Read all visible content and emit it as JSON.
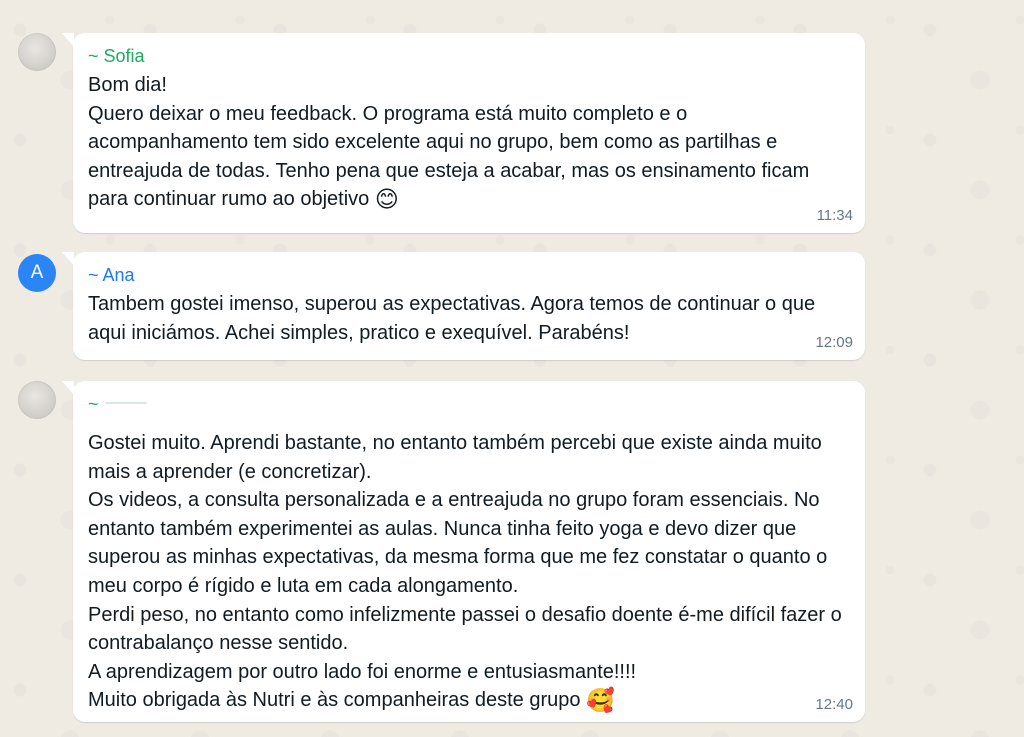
{
  "colors": {
    "background": "#efeae2",
    "bubble": "#ffffff",
    "sofia_name": "#1daa61",
    "ana_name": "#1c7ce8",
    "third_name": "#1daa61",
    "timestamp": "#667781",
    "ana_avatar": "#2b85f5"
  },
  "messages": [
    {
      "sender": "~ Sofia",
      "avatar_type": "photo",
      "text": "Bom dia!\nQuero deixar o meu feedback. O programa está muito completo e o acompanhamento tem sido excelente aqui no grupo, bem como as partilhas e entreajuda de todas. Tenho pena que esteja a acabar, mas os ensinamento ficam para continuar rumo ao objetivo",
      "emoji": "😊",
      "time": "11:34"
    },
    {
      "sender": "~ Ana",
      "avatar_letter": "A",
      "text": "Tambem gostei imenso, superou as expectativas. Agora temos de continuar o que aqui iniciámos. Achei simples, pratico e exequível. Parabéns!",
      "time": "12:09"
    },
    {
      "sender": "~",
      "avatar_type": "photo",
      "text": "Gostei muito. Aprendi bastante, no entanto também percebi que existe ainda muito mais a aprender (e concretizar).\nOs videos, a consulta personalizada e a entreajuda no grupo foram essenciais. No entanto também experimentei as aulas. Nunca tinha feito yoga e devo dizer que superou as minhas expectativas, da mesma forma que me fez constatar o quanto o meu corpo é rígido e luta em cada alongamento.\nPerdi peso, no entanto como infelizmente passei o desafio doente é-me difícil fazer o contrabalanço nesse sentido.\nA aprendizagem por outro lado foi enorme e entusiasmante!!!!\nMuito obrigada às Nutri e às companheiras deste grupo",
      "emoji": "🥰",
      "time": "12:40"
    }
  ]
}
